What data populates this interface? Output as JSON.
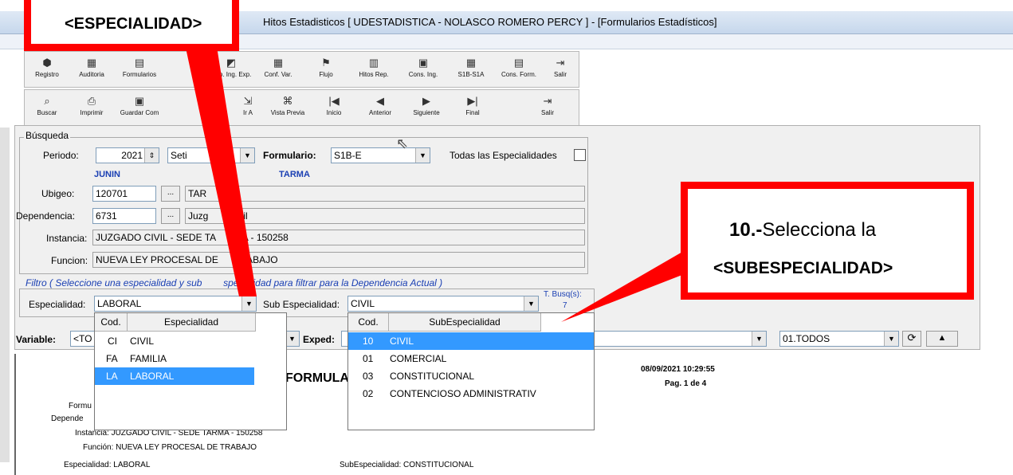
{
  "window": {
    "title": "Hitos Estadisticos  [ UDESTADISTICA - NOLASCO ROMERO PERCY ] - [Formularios Estadísticos]"
  },
  "toolbar_top": [
    {
      "label": "Registro",
      "icon": "register-icon"
    },
    {
      "label": "Auditoria",
      "icon": "audit-icon"
    },
    {
      "label": "Formularios",
      "icon": "forms-icon"
    },
    {
      "label": "",
      "icon": "blank"
    },
    {
      "label": "Rep. Ing. Exp.",
      "icon": "report-icon"
    },
    {
      "label": "Conf. Var.",
      "icon": "config-icon"
    },
    {
      "label": "Flujo",
      "icon": "flag-icon"
    },
    {
      "label": "Hitos Rep.",
      "icon": "grid-icon"
    },
    {
      "label": "Cons. Ing.",
      "icon": "query-icon"
    },
    {
      "label": "S1B-S1A",
      "icon": "table-icon"
    },
    {
      "label": "Cons. Form.",
      "icon": "form-query-icon"
    },
    {
      "label": "Salir",
      "icon": "exit-icon"
    }
  ],
  "toolbar_bottom": [
    {
      "label": "Buscar",
      "icon": "search-icon"
    },
    {
      "label": "Imprimir",
      "icon": "print-icon"
    },
    {
      "label": "Guardar Com",
      "icon": "save-icon"
    },
    {
      "label": "",
      "icon": "blank"
    },
    {
      "label": "Ir A",
      "icon": "goto-icon"
    },
    {
      "label": "Vista Previa",
      "icon": "preview-icon"
    },
    {
      "label": "Inicio",
      "icon": "first-icon",
      "glyph": "|◀"
    },
    {
      "label": "Anterior",
      "icon": "prev-icon",
      "glyph": "◀"
    },
    {
      "label": "Siguiente",
      "icon": "next-icon",
      "glyph": "▶"
    },
    {
      "label": "Final",
      "icon": "last-icon",
      "glyph": "▶|"
    },
    {
      "label": "Salir",
      "icon": "exit-icon"
    }
  ],
  "busqueda": {
    "legend": "Búsqueda",
    "periodo_label": "Periodo:",
    "periodo_year": "2021",
    "periodo_month": "Seti",
    "formulario_label": "Formulario:",
    "formulario_value": "S1B-E",
    "todas_label": "Todas las Especialidades",
    "dept": "JUNIN",
    "prov": "TARMA",
    "ubigeo_label": "Ubigeo:",
    "ubigeo_code": "120701",
    "ubigeo_name": "TAR",
    "dependencia_label": "Dependencia:",
    "dependencia_code": "6731",
    "dependencia_name": "Juzg        Civil",
    "instancia_label": "Instancia:",
    "instancia_value": "JUZGADO CIVIL - SEDE TA       MA - 150258",
    "funcion_label": "Funcion:",
    "funcion_value": "NUEVA LEY PROCESAL DE        RABAJO",
    "browse": "..."
  },
  "filtro": {
    "legend": "Filtro ( Seleccione una especialidad y sub        specialidad para filtrar para la Dependencia Actual )",
    "especialidad_label": "Especialidad:",
    "especialidad_value": "LABORAL",
    "sub_label": "Sub Especialidad:",
    "sub_value": "CIVIL",
    "tbusq_label": "T. Busq(s):",
    "tbusq_value": "7"
  },
  "variable_row": {
    "variable_label": "Variable:",
    "variable_value": "<TO",
    "exped_label": "Exped:",
    "todos_value": "01.TODOS"
  },
  "especialidad_popup": {
    "col_code": "Cod.",
    "col_name": "Especialidad",
    "rows": [
      {
        "code": "CI",
        "name": "CIVIL",
        "selected": false
      },
      {
        "code": "FA",
        "name": "FAMILIA",
        "selected": false
      },
      {
        "code": "LA",
        "name": "LABORAL",
        "selected": true
      }
    ]
  },
  "sub_popup": {
    "col_code": "Cod.",
    "col_name": "SubEspecialidad",
    "rows": [
      {
        "code": "10",
        "name": "CIVIL",
        "selected": true
      },
      {
        "code": "01",
        "name": "COMERCIAL",
        "selected": false
      },
      {
        "code": "03",
        "name": "CONSTITUCIONAL",
        "selected": false
      },
      {
        "code": "02",
        "name": "CONTENCIOSO ADMINISTRATIV",
        "selected": false
      }
    ]
  },
  "report": {
    "heading": "FORMULAR",
    "date": "08/09/2021 10:29:55",
    "page": "Pag. 1 de 4",
    "formu": "Formu",
    "depende": "Depende",
    "instancia": "Instancia: JUZGADO CIVIL - SEDE TARMA - 150258",
    "funcion": "Función: NUEVA LEY PROCESAL DE TRABAJO",
    "especialidad": "Especialidad: LABORAL",
    "subespecialidad": "SubEspecialidad: CONSTITUCIONAL"
  },
  "callout_left": {
    "text": "<ESPECIALIDAD>"
  },
  "callout_right": {
    "prefix": "10.-",
    "text": "Selecciona la",
    "line2": "<SUBESPECIALIDAD>"
  },
  "colors": {
    "callout_red": "#ff0000",
    "selection_blue": "#3399ff",
    "label_blue": "#1a3fb3"
  }
}
